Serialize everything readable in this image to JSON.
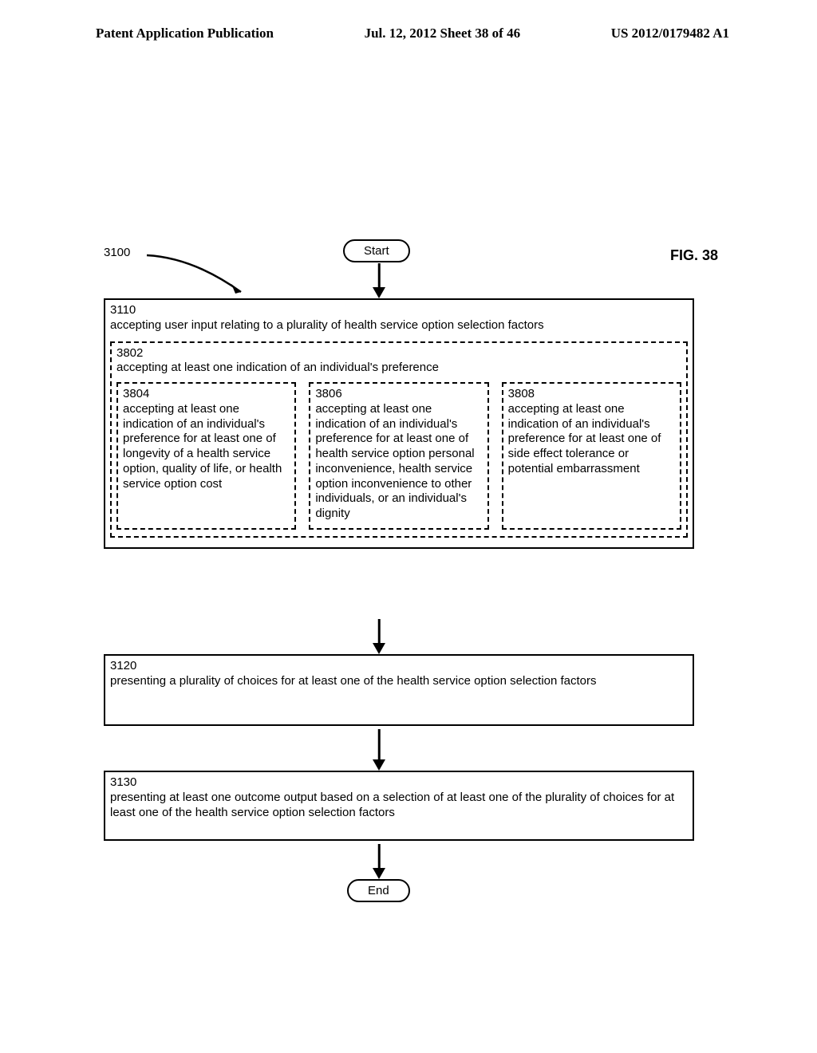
{
  "header": {
    "left": "Patent Application Publication",
    "center": "Jul. 12, 2012   Sheet 38 of 46",
    "right": "US 2012/0179482 A1"
  },
  "figure": {
    "label": "FIG. 38",
    "ref3100": "3100",
    "start": "Start",
    "end": "End",
    "box3110": {
      "ref": "3110",
      "text": "accepting user input relating to a plurality of health service option selection factors",
      "sub3802": {
        "ref": "3802",
        "text": "accepting at least one indication of an individual's preference",
        "sub3804": {
          "ref": "3804",
          "text": "accepting at least one indication of an individual's preference for at least one of longevity of a health service option, quality of life, or health service option cost"
        },
        "sub3806": {
          "ref": "3806",
          "text": "accepting at least one indication of an individual's preference for at least one of health service option personal inconvenience, health service option inconvenience to other individuals, or an individual's dignity"
        },
        "sub3808": {
          "ref": "3808",
          "text": "accepting at least one indication of an individual's preference for at least one of side effect tolerance or potential embarrassment"
        }
      }
    },
    "box3120": {
      "ref": "3120",
      "text": "presenting a plurality of choices for at least one of the health service option selection factors"
    },
    "box3130": {
      "ref": "3130",
      "text": "presenting at least one outcome output based on a selection of at least one of the plurality of choices for at least one of the health service option selection factors"
    }
  }
}
